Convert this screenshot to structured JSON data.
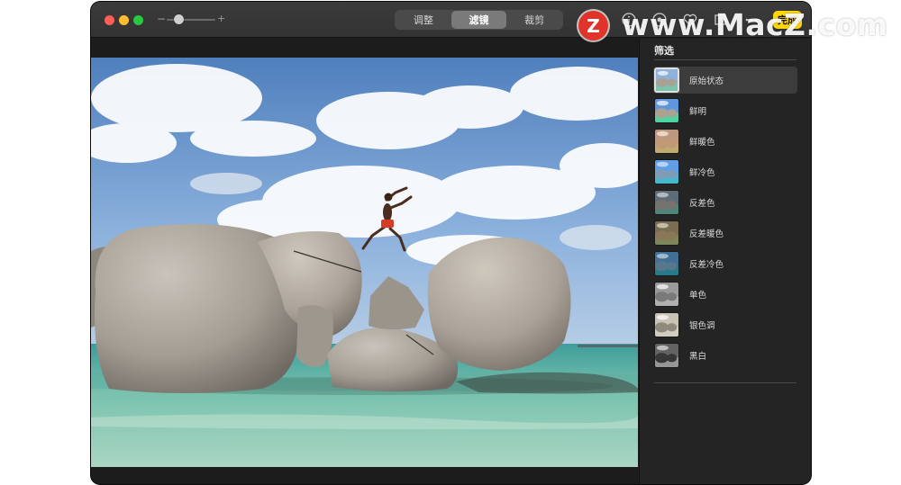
{
  "toolbar": {
    "tabs": [
      {
        "label": "调整",
        "active": false
      },
      {
        "label": "滤镜",
        "active": true
      },
      {
        "label": "裁剪",
        "active": false
      }
    ],
    "zoom_minus": "−",
    "zoom_plus": "+",
    "zoom_level": 0.25,
    "done_label": "完成",
    "icons": [
      "info-icon",
      "share-icon",
      "heart-icon",
      "crop-icon",
      "more-icon"
    ],
    "done_color": "#ffd60a"
  },
  "watermark": {
    "badge": "Z",
    "text": "www.MacZ.com"
  },
  "panel": {
    "title": "筛选",
    "filters": [
      {
        "label": "原始状态",
        "tint": "none",
        "selected": true
      },
      {
        "label": "鲜明",
        "tint": "vivid",
        "selected": false
      },
      {
        "label": "鲜暖色",
        "tint": "warm",
        "selected": false
      },
      {
        "label": "鲜冷色",
        "tint": "cool",
        "selected": false
      },
      {
        "label": "反差色",
        "tint": "dramatic",
        "selected": false
      },
      {
        "label": "反差暖色",
        "tint": "dramatic-warm",
        "selected": false
      },
      {
        "label": "反差冷色",
        "tint": "dramatic-cool",
        "selected": false
      },
      {
        "label": "单色",
        "tint": "mono",
        "selected": false
      },
      {
        "label": "银色调",
        "tint": "silvertone",
        "selected": false
      },
      {
        "label": "黑白",
        "tint": "noir",
        "selected": false
      }
    ]
  }
}
